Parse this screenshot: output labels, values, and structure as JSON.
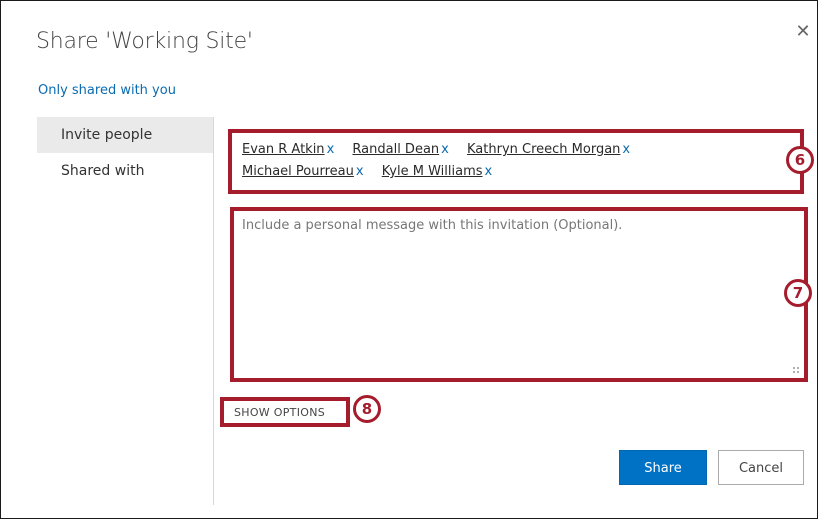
{
  "dialog": {
    "title": "Share 'Working Site'",
    "close_glyph": "✕",
    "shared_status": "Only shared with you"
  },
  "sidebar": {
    "items": [
      {
        "label": "Invite people",
        "active": true
      },
      {
        "label": "Shared with",
        "active": false
      }
    ]
  },
  "invite": {
    "people": [
      {
        "name": "Evan R Atkin",
        "remove": "x"
      },
      {
        "name": "Randall Dean",
        "remove": "x"
      },
      {
        "name": "Kathryn Creech Morgan",
        "remove": "x"
      },
      {
        "name": "Michael Pourreau",
        "remove": "x"
      },
      {
        "name": "Kyle M Williams",
        "remove": "x"
      }
    ],
    "message_placeholder": "Include a personal message with this invitation (Optional).",
    "message_value": "",
    "show_options_label": "SHOW OPTIONS"
  },
  "annotations": {
    "badge_6": "6",
    "badge_7": "7",
    "badge_8": "8",
    "highlight_color": "#a51d2d"
  },
  "buttons": {
    "share_label": "Share",
    "cancel_label": "Cancel"
  },
  "colors": {
    "accent": "#0072c6",
    "link": "#0a6bb0"
  }
}
